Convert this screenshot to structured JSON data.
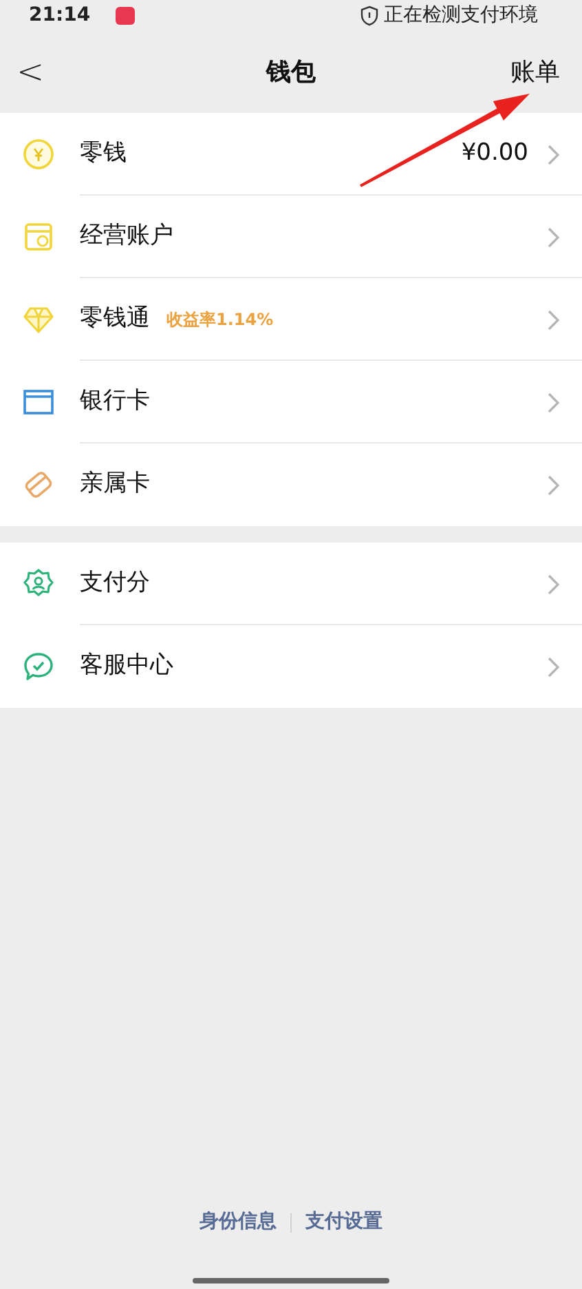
{
  "status_bar": {
    "time": "21:14",
    "status_text": "正在检测支付环境"
  },
  "header": {
    "back": "<",
    "title": "钱包",
    "action": "账单"
  },
  "groups": [
    {
      "items": [
        {
          "kind": "coin",
          "label": "零钱",
          "value": "¥0.00"
        },
        {
          "kind": "shop",
          "label": "经营账户"
        },
        {
          "kind": "diamond",
          "label": "零钱通",
          "tag": "收益率1.14%"
        },
        {
          "kind": "card",
          "label": "银行卡"
        },
        {
          "kind": "family",
          "label": "亲属卡"
        }
      ]
    },
    {
      "items": [
        {
          "kind": "score",
          "label": "支付分"
        },
        {
          "kind": "service",
          "label": "客服中心"
        }
      ]
    }
  ],
  "footer_links": [
    "身份信息",
    "支付设置"
  ]
}
